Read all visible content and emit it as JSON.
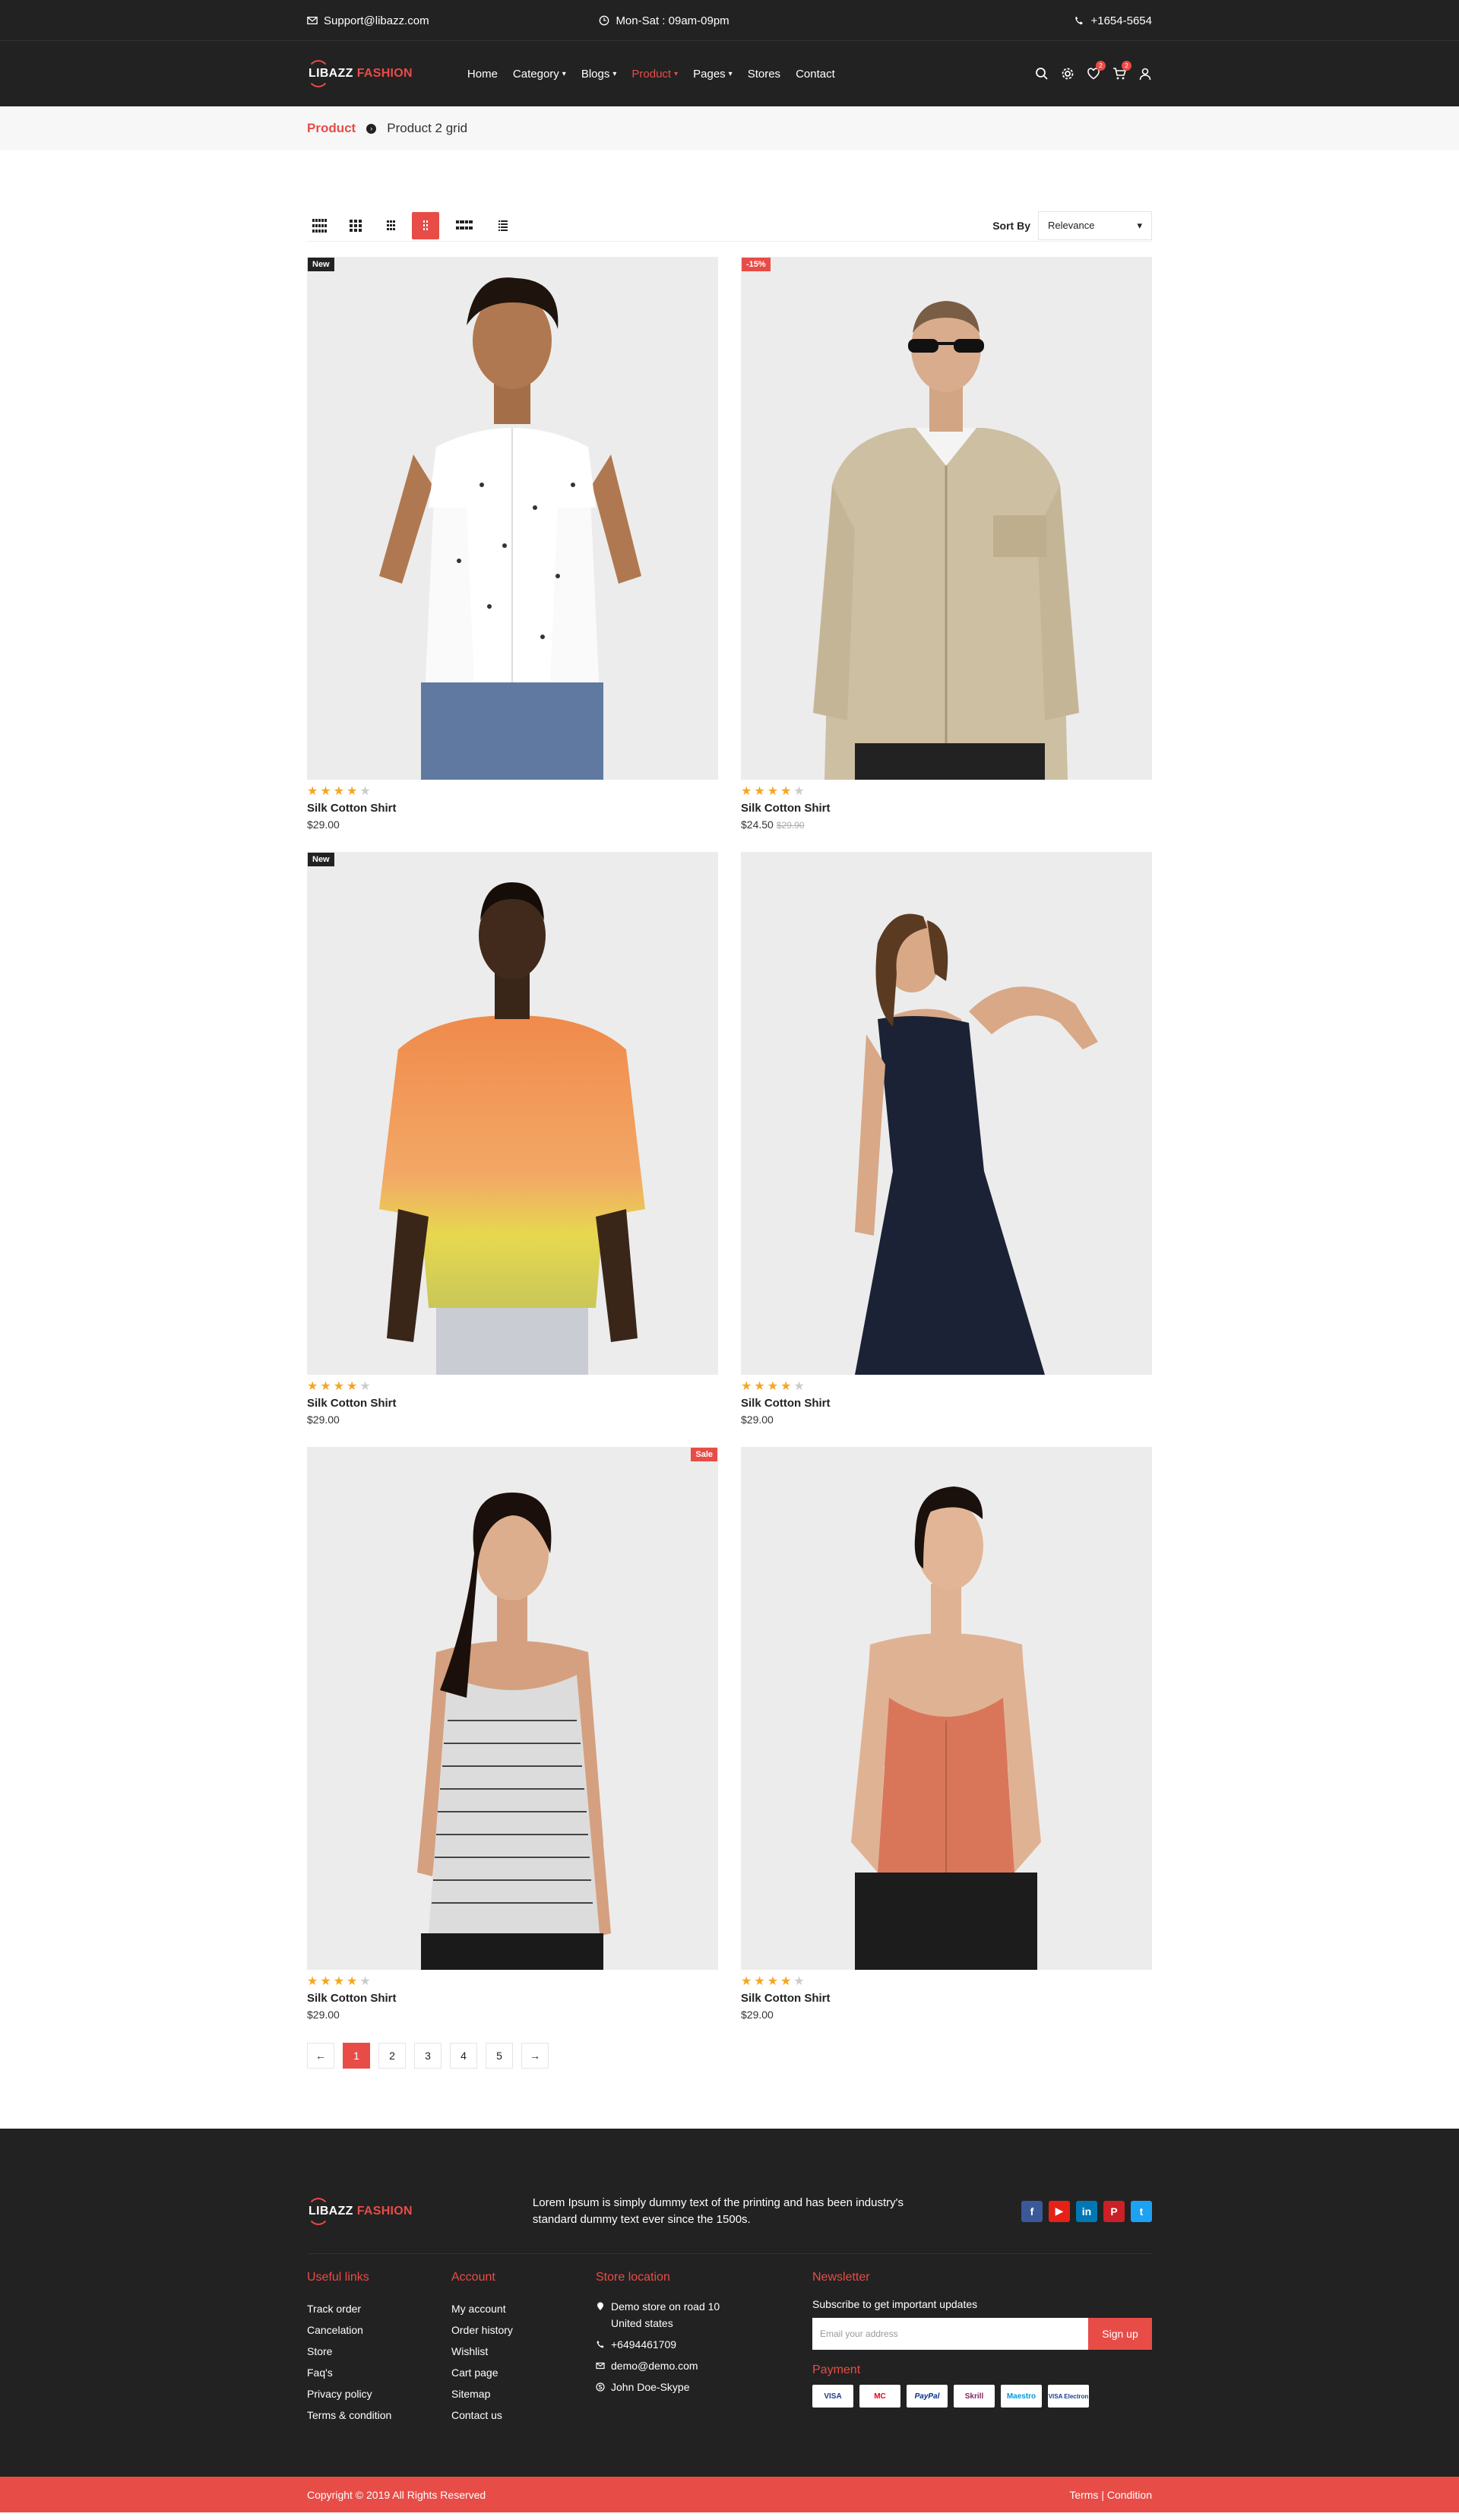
{
  "topbar": {
    "email": "Support@libazz.com",
    "hours": "Mon-Sat : 09am-09pm",
    "phone": "+1654-5654"
  },
  "header": {
    "logo_part1": "LIBAZZ",
    "logo_part2": "FASHION",
    "nav": [
      {
        "label": "Home"
      },
      {
        "label": "Category"
      },
      {
        "label": "Blogs"
      },
      {
        "label": "Product"
      },
      {
        "label": "Pages"
      },
      {
        "label": "Stores"
      },
      {
        "label": "Contact"
      }
    ],
    "wishlist_count": "2",
    "cart_count": "2"
  },
  "breadcrumb": {
    "section": "Product",
    "page": "Product 2 grid"
  },
  "toolbar": {
    "sort_label": "Sort By",
    "sort_value": "Relevance",
    "sort_arrow": "▾"
  },
  "products": [
    {
      "tag": "New",
      "name": "Silk Cotton Shirt",
      "price": "$29.00",
      "old_price": "",
      "rating": 4
    },
    {
      "tag": "-15%",
      "name": "Silk Cotton Shirt",
      "price": "$24.50",
      "old_price": "$29.90",
      "rating": 4
    },
    {
      "tag": "New",
      "name": "Silk Cotton Shirt",
      "price": "$29.00",
      "old_price": "",
      "rating": 4
    },
    {
      "tag": "",
      "name": "Silk Cotton Shirt",
      "price": "$29.00",
      "old_price": "",
      "rating": 4
    },
    {
      "tag": "Sale",
      "name": "Silk Cotton Shirt",
      "price": "$29.00",
      "old_price": "",
      "rating": 4
    },
    {
      "tag": "",
      "name": "Silk Cotton Shirt",
      "price": "$29.00",
      "old_price": "",
      "rating": 4
    }
  ],
  "pagination": {
    "prev": "←",
    "pages": [
      "1",
      "2",
      "3",
      "4",
      "5"
    ],
    "next": "→"
  },
  "footer": {
    "logo_part1": "LIBAZZ",
    "logo_part2": "FASHION",
    "description": "Lorem Ipsum is simply dummy text of the printing and has been industry's standard dummy text ever since the 1500s.",
    "useful_links": {
      "title": "Useful links",
      "items": [
        "Track order",
        "Cancelation",
        "Store",
        "Faq's",
        "Privacy policy",
        "Terms & condition"
      ]
    },
    "account": {
      "title": "Account",
      "items": [
        "My account",
        "Order history",
        "Wishlist",
        "Cart page",
        "Sitemap",
        "Contact us"
      ]
    },
    "store": {
      "title": "Store location",
      "address": "Demo store on road 10 United states",
      "phone": "+6494461709",
      "email": "demo@demo.com",
      "skype": "John Doe-Skype"
    },
    "newsletter": {
      "title": "Newsletter",
      "subtitle": "Subscribe to get important updates",
      "placeholder": "Email your address",
      "button": "Sign up"
    },
    "payment": {
      "title": "Payment",
      "methods": [
        "VISA",
        "MC",
        "PayPal",
        "Skrill",
        "Maestro",
        "VISA Electron"
      ]
    },
    "copyright": "Copyright © 2019 All Rights Reserved",
    "terms": "Terms | Condition"
  },
  "colors": {
    "accent": "#e84c47",
    "dark": "#222222"
  }
}
